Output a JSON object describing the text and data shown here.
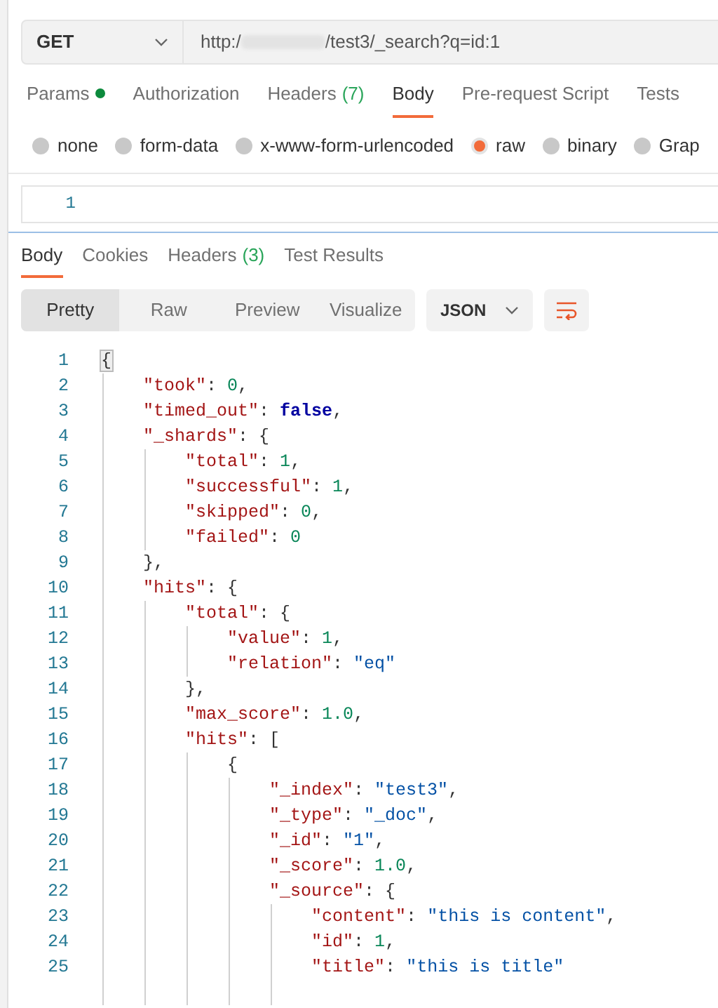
{
  "request": {
    "method": "GET",
    "url_prefix": "http:/",
    "url_suffix": "/test3/_search?q=id:1"
  },
  "request_tabs": [
    {
      "label": "Params",
      "selected": false,
      "dot": true
    },
    {
      "label": "Authorization",
      "selected": false
    },
    {
      "label": "Headers",
      "count": "(7)",
      "selected": false
    },
    {
      "label": "Body",
      "selected": true
    },
    {
      "label": "Pre-request Script",
      "selected": false
    },
    {
      "label": "Tests",
      "selected": false
    }
  ],
  "body_types": [
    {
      "label": "none",
      "selected": false
    },
    {
      "label": "form-data",
      "selected": false
    },
    {
      "label": "x-www-form-urlencoded",
      "selected": false
    },
    {
      "label": "raw",
      "selected": true
    },
    {
      "label": "binary",
      "selected": false
    },
    {
      "label": "Grap",
      "selected": false
    }
  ],
  "body_editor": {
    "line_numbers": [
      "1"
    ]
  },
  "response_tabs": [
    {
      "label": "Body",
      "selected": true
    },
    {
      "label": "Cookies",
      "selected": false
    },
    {
      "label": "Headers",
      "count": "(3)",
      "selected": false
    },
    {
      "label": "Test Results",
      "selected": false
    }
  ],
  "view_modes": [
    {
      "label": "Pretty",
      "selected": true
    },
    {
      "label": "Raw",
      "selected": false
    },
    {
      "label": "Preview",
      "selected": false
    },
    {
      "label": "Visualize",
      "selected": false
    }
  ],
  "format": "JSON",
  "response_lines": [
    {
      "number": "1",
      "tokens": [
        {
          "kind": "brace",
          "text": "{"
        }
      ]
    },
    {
      "number": "2",
      "tokens": [
        {
          "kind": "key",
          "text": "    \"took\""
        },
        {
          "kind": "punct",
          "text": ": "
        },
        {
          "kind": "number",
          "text": "0"
        },
        {
          "kind": "punct",
          "text": ","
        }
      ]
    },
    {
      "number": "3",
      "tokens": [
        {
          "kind": "key",
          "text": "    \"timed_out\""
        },
        {
          "kind": "punct",
          "text": ": "
        },
        {
          "kind": "boolean",
          "text": "false"
        },
        {
          "kind": "punct",
          "text": ","
        }
      ]
    },
    {
      "number": "4",
      "tokens": [
        {
          "kind": "key",
          "text": "    \"_shards\""
        },
        {
          "kind": "punct",
          "text": ": {"
        }
      ]
    },
    {
      "number": "5",
      "tokens": [
        {
          "kind": "key",
          "text": "        \"total\""
        },
        {
          "kind": "punct",
          "text": ": "
        },
        {
          "kind": "number",
          "text": "1"
        },
        {
          "kind": "punct",
          "text": ","
        }
      ]
    },
    {
      "number": "6",
      "tokens": [
        {
          "kind": "key",
          "text": "        \"successful\""
        },
        {
          "kind": "punct",
          "text": ": "
        },
        {
          "kind": "number",
          "text": "1"
        },
        {
          "kind": "punct",
          "text": ","
        }
      ]
    },
    {
      "number": "7",
      "tokens": [
        {
          "kind": "key",
          "text": "        \"skipped\""
        },
        {
          "kind": "punct",
          "text": ": "
        },
        {
          "kind": "number",
          "text": "0"
        },
        {
          "kind": "punct",
          "text": ","
        }
      ]
    },
    {
      "number": "8",
      "tokens": [
        {
          "kind": "key",
          "text": "        \"failed\""
        },
        {
          "kind": "punct",
          "text": ": "
        },
        {
          "kind": "number",
          "text": "0"
        }
      ]
    },
    {
      "number": "9",
      "tokens": [
        {
          "kind": "punct",
          "text": "    },"
        }
      ]
    },
    {
      "number": "10",
      "tokens": [
        {
          "kind": "key",
          "text": "    \"hits\""
        },
        {
          "kind": "punct",
          "text": ": {"
        }
      ]
    },
    {
      "number": "11",
      "tokens": [
        {
          "kind": "key",
          "text": "        \"total\""
        },
        {
          "kind": "punct",
          "text": ": {"
        }
      ]
    },
    {
      "number": "12",
      "tokens": [
        {
          "kind": "key",
          "text": "            \"value\""
        },
        {
          "kind": "punct",
          "text": ": "
        },
        {
          "kind": "number",
          "text": "1"
        },
        {
          "kind": "punct",
          "text": ","
        }
      ]
    },
    {
      "number": "13",
      "tokens": [
        {
          "kind": "key",
          "text": "            \"relation\""
        },
        {
          "kind": "punct",
          "text": ": "
        },
        {
          "kind": "string",
          "text": "\"eq\""
        }
      ]
    },
    {
      "number": "14",
      "tokens": [
        {
          "kind": "punct",
          "text": "        },"
        }
      ]
    },
    {
      "number": "15",
      "tokens": [
        {
          "kind": "key",
          "text": "        \"max_score\""
        },
        {
          "kind": "punct",
          "text": ": "
        },
        {
          "kind": "number",
          "text": "1.0"
        },
        {
          "kind": "punct",
          "text": ","
        }
      ]
    },
    {
      "number": "16",
      "tokens": [
        {
          "kind": "key",
          "text": "        \"hits\""
        },
        {
          "kind": "punct",
          "text": ": ["
        }
      ]
    },
    {
      "number": "17",
      "tokens": [
        {
          "kind": "punct",
          "text": "            {"
        }
      ]
    },
    {
      "number": "18",
      "tokens": [
        {
          "kind": "key",
          "text": "                \"_index\""
        },
        {
          "kind": "punct",
          "text": ": "
        },
        {
          "kind": "string",
          "text": "\"test3\""
        },
        {
          "kind": "punct",
          "text": ","
        }
      ]
    },
    {
      "number": "19",
      "tokens": [
        {
          "kind": "key",
          "text": "                \"_type\""
        },
        {
          "kind": "punct",
          "text": ": "
        },
        {
          "kind": "string",
          "text": "\"_doc\""
        },
        {
          "kind": "punct",
          "text": ","
        }
      ]
    },
    {
      "number": "20",
      "tokens": [
        {
          "kind": "key",
          "text": "                \"_id\""
        },
        {
          "kind": "punct",
          "text": ": "
        },
        {
          "kind": "string",
          "text": "\"1\""
        },
        {
          "kind": "punct",
          "text": ","
        }
      ]
    },
    {
      "number": "21",
      "tokens": [
        {
          "kind": "key",
          "text": "                \"_score\""
        },
        {
          "kind": "punct",
          "text": ": "
        },
        {
          "kind": "number",
          "text": "1.0"
        },
        {
          "kind": "punct",
          "text": ","
        }
      ]
    },
    {
      "number": "22",
      "tokens": [
        {
          "kind": "key",
          "text": "                \"_source\""
        },
        {
          "kind": "punct",
          "text": ": {"
        }
      ]
    },
    {
      "number": "23",
      "tokens": [
        {
          "kind": "key",
          "text": "                    \"content\""
        },
        {
          "kind": "punct",
          "text": ": "
        },
        {
          "kind": "string",
          "text": "\"this is content\""
        },
        {
          "kind": "punct",
          "text": ","
        }
      ]
    },
    {
      "number": "24",
      "tokens": [
        {
          "kind": "key",
          "text": "                    \"id\""
        },
        {
          "kind": "punct",
          "text": ": "
        },
        {
          "kind": "number",
          "text": "1"
        },
        {
          "kind": "punct",
          "text": ","
        }
      ]
    },
    {
      "number": "25",
      "tokens": [
        {
          "kind": "key",
          "text": "                    \"title\""
        },
        {
          "kind": "punct",
          "text": ": "
        },
        {
          "kind": "string",
          "text": "\"this is title\""
        }
      ]
    }
  ]
}
